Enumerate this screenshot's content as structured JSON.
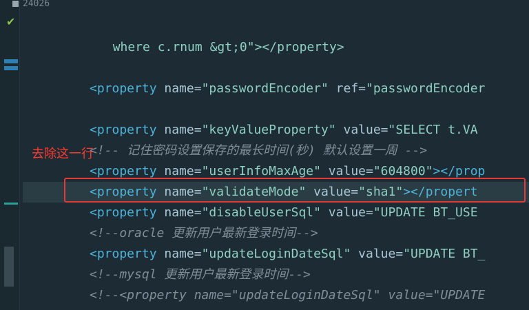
{
  "top_line": {
    "label": "24026"
  },
  "annotation": {
    "text": "去除这一行"
  },
  "lines": {
    "l1": "where c.rnum &gt;0\"></property>",
    "l2_tag": "<property",
    "l2_a1": " name=",
    "l2_v1": "\"passwordEncoder\"",
    "l2_a2": " ref=",
    "l2_v2": "\"passwordEncoder",
    "l3_tag": "<property",
    "l3_a1": " name=",
    "l3_v1": "\"keyValueProperty\"",
    "l3_a2": " value=",
    "l3_v2": "\"SELECT t.VA",
    "l4_comment": "<!-- 记住密码设置保存的最长时间(秒) 默认设置一周 -->",
    "l5_tag": "<property",
    "l5_a1": " name=",
    "l5_v1": "\"userInfoMaxAge\"",
    "l5_a2": " value=",
    "l5_v2": "\"604800\"",
    "l5_end": "></prop",
    "l6_tag": "<property",
    "l6_a1": " name=",
    "l6_v1": "\"validateMode\"",
    "l6_a2": " value=",
    "l6_v2": "\"sha1\"",
    "l6_end": "></propert",
    "l7_tag": "<property",
    "l7_a1": " name=",
    "l7_v1": "\"disableUserSql\"",
    "l7_a2": " value=",
    "l7_v2": "\"UPDATE BT_USE",
    "l8_comment": "<!--oracle 更新用户最新登录时间-->",
    "l9_tag": "<property",
    "l9_a1": " name=",
    "l9_v1": "\"updateLoginDateSql\"",
    "l9_a2": " value=",
    "l9_v2": "\"UPDATE BT_",
    "l10_comment": "<!--mysql 更新用户最新登录时间-->",
    "l11_comment": "<!--<property name=\"updateLoginDateSql\" value=\"UPDATE"
  },
  "colors": {
    "background": "#1c2b34",
    "tag": "#4fb3d9",
    "string": "#8fd0c2",
    "comment": "#7f8f98",
    "highlight_border": "#e53935"
  },
  "icons": {
    "check": "checkmark-icon"
  }
}
